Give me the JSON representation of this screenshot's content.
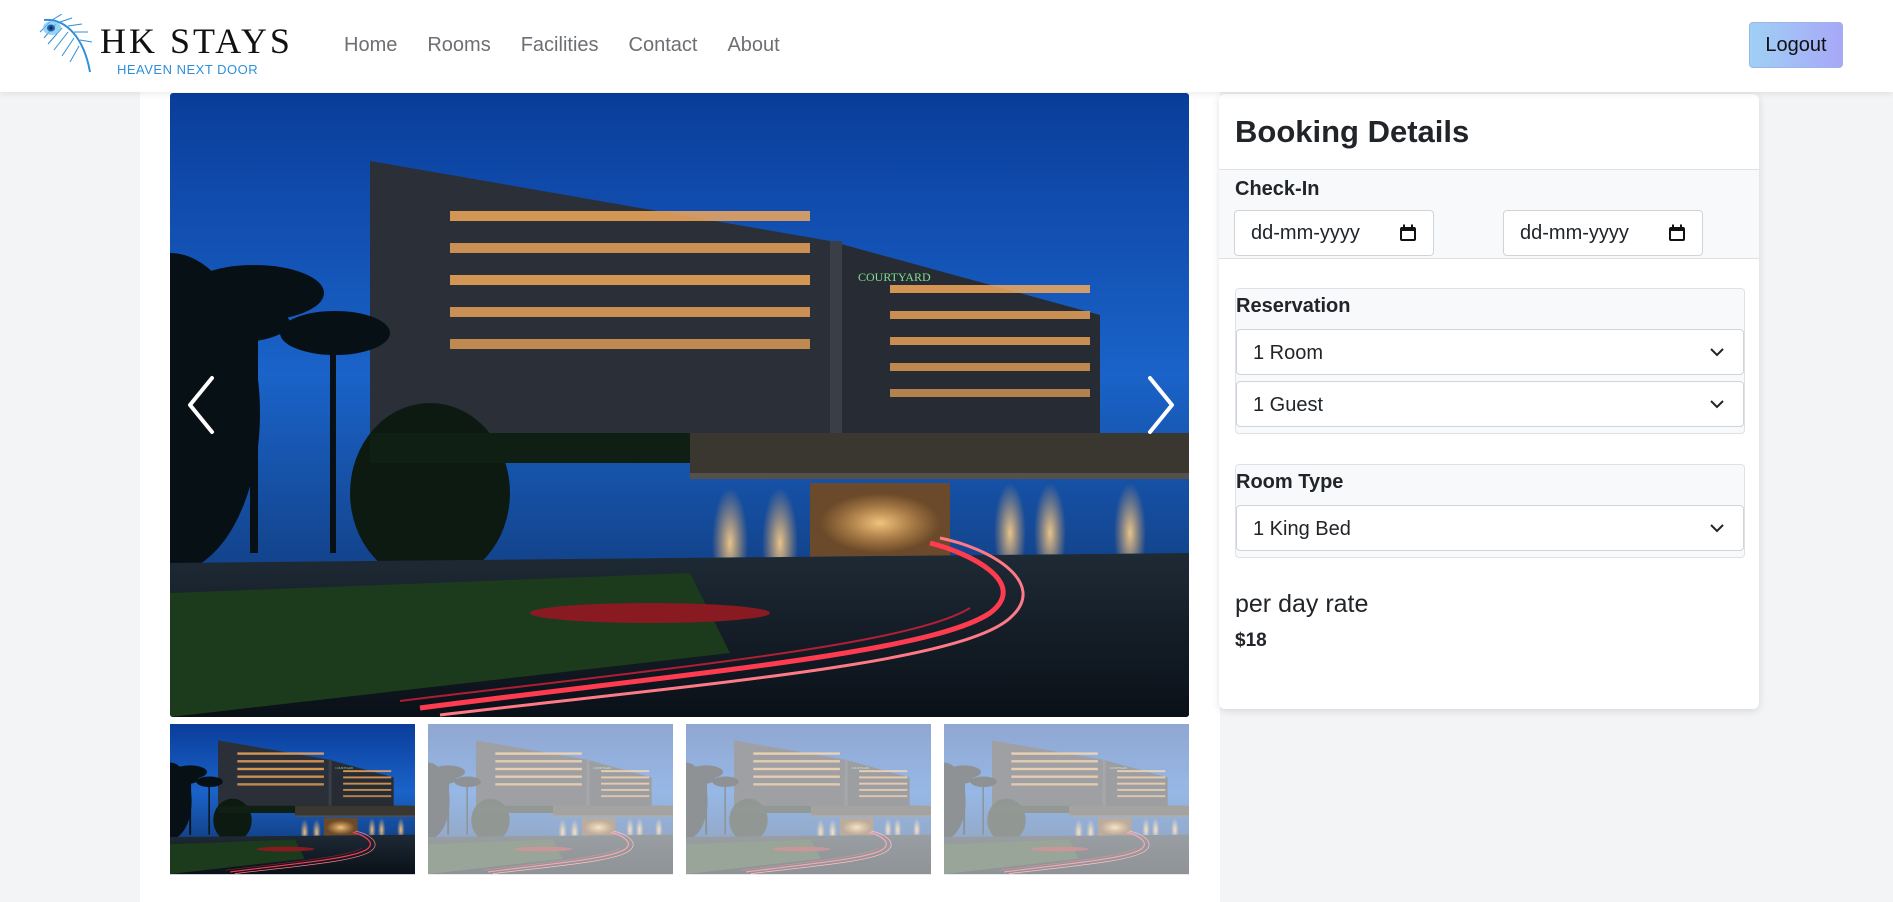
{
  "brand": {
    "title": "HK STAYS",
    "tagline": "HEAVEN NEXT DOOR",
    "accent_color": "#2f8fd8",
    "icon": "peacock-feather-icon"
  },
  "nav": {
    "links": [
      {
        "label": "Home"
      },
      {
        "label": "Rooms"
      },
      {
        "label": "Facilities"
      },
      {
        "label": "Contact"
      },
      {
        "label": "About"
      }
    ],
    "logout_label": "Logout"
  },
  "gallery": {
    "prev_icon": "chevron-left-icon",
    "next_icon": "chevron-right-icon",
    "thumbnail_count": 4,
    "active_thumbnail": 1
  },
  "booking": {
    "title": "Booking Details",
    "checkin": {
      "label": "Check-In",
      "start_placeholder": "dd-mm-yyyy",
      "end_placeholder": "dd-mm-yyyy"
    },
    "reservation": {
      "label": "Reservation",
      "rooms_selected": "1 Room",
      "guests_selected": "1 Guest"
    },
    "room_type": {
      "label": "Room Type",
      "selected": "1 King Bed"
    },
    "rate": {
      "heading": "per day rate",
      "value": "$18"
    }
  }
}
